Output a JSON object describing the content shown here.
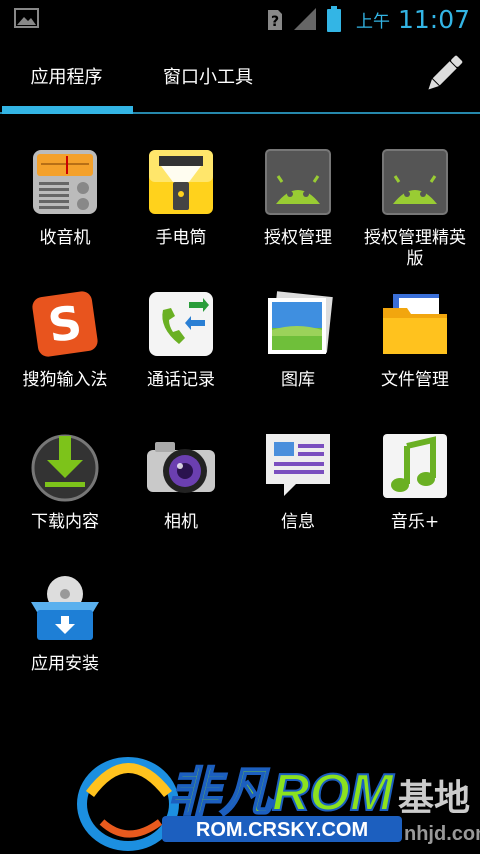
{
  "status_bar": {
    "ampm": "上午",
    "time": "11:07",
    "icons": [
      "image-icon",
      "unknown-sim-icon",
      "signal-icon",
      "battery-icon"
    ]
  },
  "tabs": [
    {
      "label": "应用程序",
      "selected": true
    },
    {
      "label": "窗口小工具",
      "selected": false
    }
  ],
  "store_icon": "pencil-icon",
  "apps": [
    {
      "label": "收音机",
      "icon": "radio-icon"
    },
    {
      "label": "手电筒",
      "icon": "flashlight-icon"
    },
    {
      "label": "授权管理",
      "icon": "android-icon"
    },
    {
      "label": "授权管理精英版",
      "icon": "android-icon"
    },
    {
      "label": "搜狗输入法",
      "icon": "sogou-icon"
    },
    {
      "label": "通话记录",
      "icon": "call-log-icon"
    },
    {
      "label": "图库",
      "icon": "gallery-icon"
    },
    {
      "label": "文件管理",
      "icon": "folder-icon"
    },
    {
      "label": "下载内容",
      "icon": "download-icon"
    },
    {
      "label": "相机",
      "icon": "camera-icon"
    },
    {
      "label": "信息",
      "icon": "message-icon"
    },
    {
      "label": "音乐+",
      "icon": "music-icon"
    },
    {
      "label": "应用安装",
      "icon": "installer-icon"
    }
  ],
  "watermark": {
    "brand": "非凡ROM",
    "base": "基地",
    "url": "ROM.CRSKY.COM",
    "side": "nhjd.com"
  },
  "colors": {
    "accent": "#33b5e5",
    "background": "#000000"
  }
}
